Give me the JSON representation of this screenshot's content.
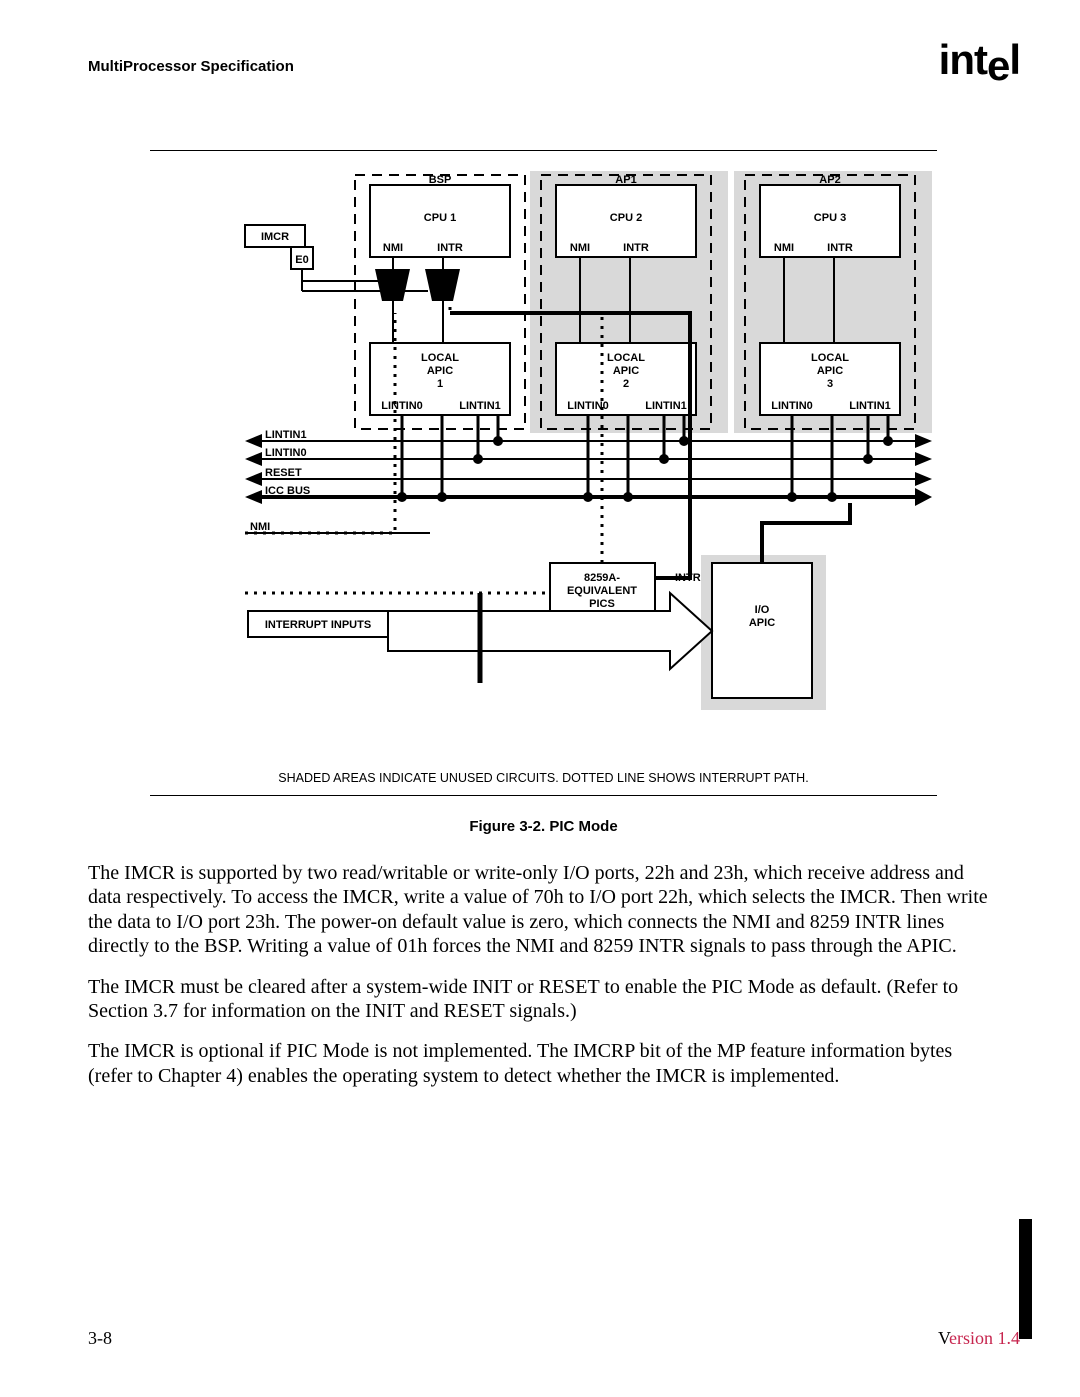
{
  "header": {
    "title": "MultiProcessor Specification",
    "logo": "intel"
  },
  "figure": {
    "caption": "Figure 3-2.  PIC Mode",
    "note": "SHADED AREAS INDICATE UNUSED CIRCUITS. DOTTED LINE SHOWS INTERRUPT PATH.",
    "labels": {
      "imcr": "IMCR",
      "e0": "E0",
      "bsp": "BSP",
      "ap1": "AP1",
      "ap2": "AP2",
      "cpu1": "CPU 1",
      "cpu2": "CPU 2",
      "cpu3": "CPU 3",
      "nmi": "NMI",
      "intr": "INTR",
      "local_apic1_a": "LOCAL",
      "local_apic1_b": "APIC",
      "local_apic1_c": "1",
      "local_apic2_a": "LOCAL",
      "local_apic2_b": "APIC",
      "local_apic2_c": "2",
      "local_apic3_a": "LOCAL",
      "local_apic3_b": "APIC",
      "local_apic3_c": "3",
      "lintin0": "LINTIN0",
      "lintin1": "LINTIN1",
      "bus_lintin1": "LINTIN1",
      "bus_lintin0": "LINTIN0",
      "bus_reset": "RESET",
      "bus_icc": "ICC BUS",
      "bus_nmi": "NMI",
      "pics_a": "8259A-",
      "pics_b": "EQUIVALENT",
      "pics_c": "PICS",
      "pics_intr": "INTR",
      "io_apic_a": "I/O",
      "io_apic_b": "APIC",
      "interrupt_inputs": "INTERRUPT INPUTS"
    }
  },
  "paragraphs": {
    "p1": "The IMCR is supported by two read/writable or write-only I/O ports, 22h and 23h, which receive address and data respectively.  To access the IMCR, write a value of 70h to I/O port 22h, which selects the IMCR.  Then write the data to I/O port 23h.  The power-on default value is zero, which connects the NMI and 8259 INTR lines directly to the BSP.  Writing a value of 01h forces the NMI and 8259 INTR signals to pass through the APIC.",
    "p2": "The IMCR must be cleared after a system-wide INIT or RESET to enable the PIC Mode as default.  (Refer to Section 3.7 for information on the INIT and RESET signals.)",
    "p3": "The IMCR is optional if PIC Mode is not implemented.  The IMCRP bit of the MP feature information bytes (refer to Chapter 4) enables the operating system to detect whether the IMCR is implemented."
  },
  "footer": {
    "page": "3-8",
    "version_prefix": "V",
    "version_rest": "ersion 1.4"
  }
}
